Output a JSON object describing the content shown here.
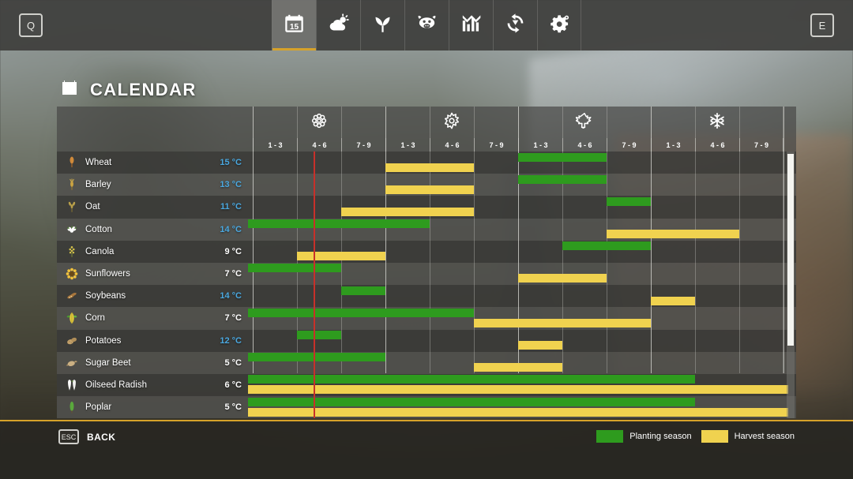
{
  "topbar": {
    "left_key": "Q",
    "right_key": "E",
    "nav": [
      {
        "label": "Calendar",
        "icon": "calendar-icon",
        "active": true
      },
      {
        "label": "Weather",
        "icon": "weather-icon",
        "active": false
      },
      {
        "label": "Plants",
        "icon": "seedling-icon",
        "active": false
      },
      {
        "label": "Animals",
        "icon": "cow-icon",
        "active": false
      },
      {
        "label": "Statistics",
        "icon": "bar-chart-icon",
        "active": false
      },
      {
        "label": "Production",
        "icon": "production-icon",
        "active": false
      },
      {
        "label": "Settings",
        "icon": "gear-icon",
        "active": false
      }
    ]
  },
  "page": {
    "title": "CALENDAR",
    "title_icon": "calendar-icon"
  },
  "calendar": {
    "seasons": [
      {
        "name": "Spring",
        "icon": "flower-icon"
      },
      {
        "name": "Summer",
        "icon": "sun-icon"
      },
      {
        "name": "Autumn",
        "icon": "leaf-icon"
      },
      {
        "name": "Winter",
        "icon": "snowflake-icon"
      }
    ],
    "period_labels": [
      "1 - 3",
      "4 - 6",
      "7 - 9",
      "1 - 3",
      "4 - 6",
      "7 - 9",
      "1 - 3",
      "4 - 6",
      "7 - 9",
      "1 - 3",
      "4 - 6",
      "7 - 9"
    ],
    "column_count": 12,
    "current_day_marker_column": 0.1,
    "colors": {
      "planting": "#2e9b1e",
      "harvest": "#f0d24f",
      "day_marker": "#c8302a",
      "accent": "#d6a22a",
      "temp_warm": "#4aa8e0",
      "temp_cold": "#ffffff"
    },
    "rows": [
      {
        "name": "Wheat",
        "icon": "wheat-icon",
        "temp": "15 °C",
        "temp_warm": true,
        "planting": [
          {
            "start": 6.0,
            "end": 8.0
          }
        ],
        "harvest": [
          {
            "start": 3.0,
            "end": 5.0
          }
        ]
      },
      {
        "name": "Barley",
        "icon": "barley-icon",
        "temp": "13 °C",
        "temp_warm": true,
        "planting": [
          {
            "start": 6.0,
            "end": 8.0
          }
        ],
        "harvest": [
          {
            "start": 3.0,
            "end": 5.0
          }
        ]
      },
      {
        "name": "Oat",
        "icon": "oat-icon",
        "temp": "11 °C",
        "temp_warm": true,
        "planting": [
          {
            "start": 8.0,
            "end": 9.0
          }
        ],
        "harvest": [
          {
            "start": 2.0,
            "end": 5.0
          }
        ]
      },
      {
        "name": "Cotton",
        "icon": "cotton-icon",
        "temp": "14 °C",
        "temp_warm": true,
        "planting": [
          {
            "start": -0.1,
            "end": 4.0
          }
        ],
        "harvest": [
          {
            "start": 8.0,
            "end": 11.0
          }
        ]
      },
      {
        "name": "Canola",
        "icon": "canola-icon",
        "temp": "9 °C",
        "temp_warm": false,
        "planting": [
          {
            "start": 7.0,
            "end": 9.0
          }
        ],
        "harvest": [
          {
            "start": 1.0,
            "end": 3.0
          }
        ]
      },
      {
        "name": "Sunflowers",
        "icon": "sunflower-icon",
        "temp": "7 °C",
        "temp_warm": false,
        "planting": [
          {
            "start": -0.1,
            "end": 2.0
          }
        ],
        "harvest": [
          {
            "start": 6.0,
            "end": 8.0
          }
        ]
      },
      {
        "name": "Soybeans",
        "icon": "soybean-icon",
        "temp": "14 °C",
        "temp_warm": true,
        "planting": [
          {
            "start": 2.0,
            "end": 3.0
          }
        ],
        "harvest": [
          {
            "start": 9.0,
            "end": 10.0
          }
        ]
      },
      {
        "name": "Corn",
        "icon": "corn-icon",
        "temp": "7 °C",
        "temp_warm": false,
        "planting": [
          {
            "start": -0.1,
            "end": 5.0
          }
        ],
        "harvest": [
          {
            "start": 5.0,
            "end": 9.0
          }
        ]
      },
      {
        "name": "Potatoes",
        "icon": "potato-icon",
        "temp": "12 °C",
        "temp_warm": true,
        "planting": [
          {
            "start": 1.0,
            "end": 2.0
          }
        ],
        "harvest": [
          {
            "start": 6.0,
            "end": 7.0
          }
        ]
      },
      {
        "name": "Sugar Beet",
        "icon": "sugarbeet-icon",
        "temp": "5 °C",
        "temp_warm": false,
        "planting": [
          {
            "start": -0.1,
            "end": 3.0
          }
        ],
        "harvest": [
          {
            "start": 5.0,
            "end": 7.0
          }
        ]
      },
      {
        "name": "Oilseed Radish",
        "icon": "radish-icon",
        "temp": "6 °C",
        "temp_warm": false,
        "planting": [
          {
            "start": -0.1,
            "end": 10.0
          }
        ],
        "harvest": [
          {
            "start": -0.1,
            "end": 12.1
          }
        ]
      },
      {
        "name": "Poplar",
        "icon": "poplar-icon",
        "temp": "5 °C",
        "temp_warm": false,
        "planting": [
          {
            "start": -0.1,
            "end": 10.0
          }
        ],
        "harvest": [
          {
            "start": -0.1,
            "end": 12.1
          }
        ]
      }
    ]
  },
  "bottombar": {
    "back_key": "ESC",
    "back_label": "BACK",
    "legend": [
      {
        "label": "Planting season",
        "color": "#2e9b1e"
      },
      {
        "label": "Harvest season",
        "color": "#f0d24f"
      }
    ]
  }
}
